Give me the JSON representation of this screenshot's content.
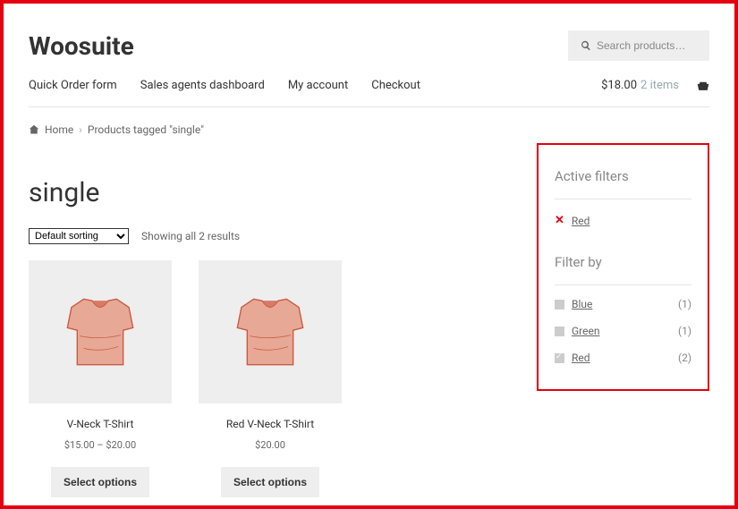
{
  "site_title": "Woosuite",
  "search": {
    "placeholder": "Search products…"
  },
  "nav": {
    "items": [
      "Quick Order form",
      "Sales agents dashboard",
      "My account",
      "Checkout"
    ]
  },
  "cart": {
    "price": "$18.00",
    "items": "2 items"
  },
  "breadcrumb": {
    "home": "Home",
    "sep": "›",
    "current": "Products tagged \"single\""
  },
  "page_title": "single",
  "sort": {
    "selected": "Default sorting"
  },
  "result_count": "Showing all 2 results",
  "products": [
    {
      "name": "V-Neck T-Shirt",
      "price": "$15.00 – $20.00",
      "button": "Select options"
    },
    {
      "name": "Red V-Neck T-Shirt",
      "price": "$20.00",
      "button": "Select options"
    }
  ],
  "sidebar": {
    "active_filters_heading": "Active filters",
    "active_filter": "Red",
    "filter_by_heading": "Filter by",
    "options": [
      {
        "label": "Blue",
        "count": "(1)",
        "checked": false
      },
      {
        "label": "Green",
        "count": "(1)",
        "checked": false
      },
      {
        "label": "Red",
        "count": "(2)",
        "checked": true
      }
    ]
  }
}
